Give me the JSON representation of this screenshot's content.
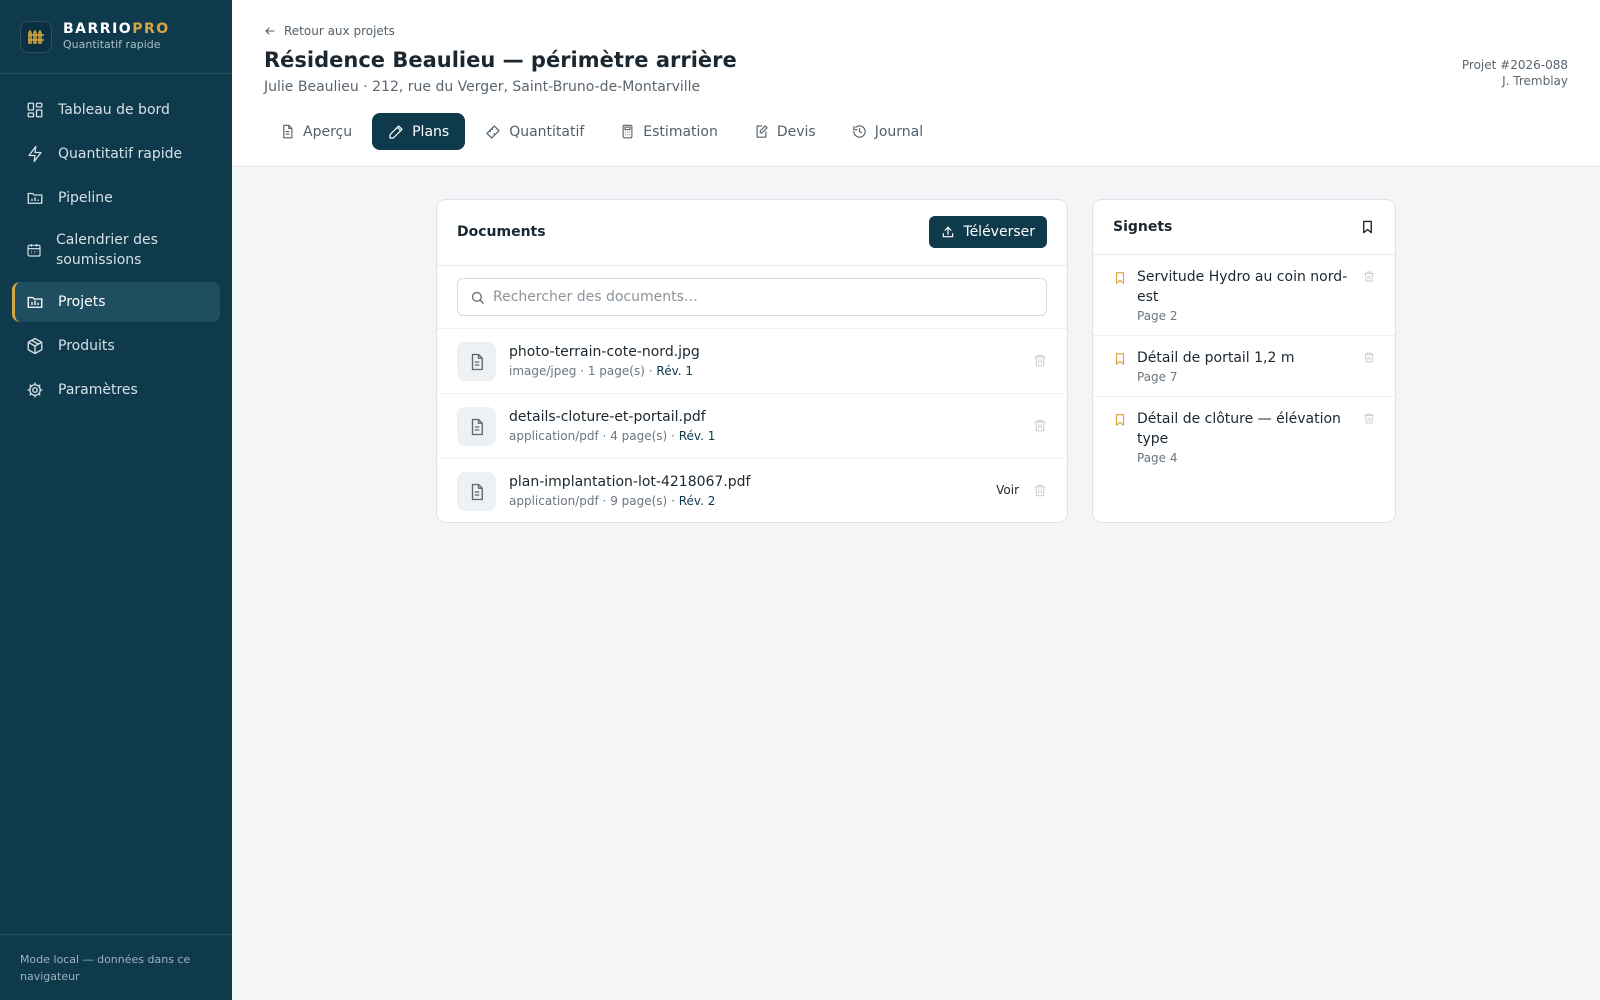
{
  "brand": {
    "name_main": "BARRIO",
    "name_accent": "PRO",
    "subtitle": "Quantitatif rapide"
  },
  "sidebar": {
    "items": [
      {
        "label": "Tableau de bord",
        "icon": "dashboard-icon"
      },
      {
        "label": "Quantitatif rapide",
        "icon": "lightning-icon"
      },
      {
        "label": "Pipeline",
        "icon": "pipeline-icon"
      },
      {
        "label": "Calendrier des soumissions",
        "icon": "calendar-icon"
      },
      {
        "label": "Projets",
        "icon": "projects-icon",
        "active": true
      },
      {
        "label": "Produits",
        "icon": "package-icon"
      },
      {
        "label": "Paramètres",
        "icon": "gear-icon"
      }
    ],
    "footer": "Mode local — données dans ce navigateur"
  },
  "header": {
    "back_label": "Retour aux projets",
    "title": "Résidence Beaulieu — périmètre arrière",
    "subtitle": "Julie Beaulieu · 212, rue du Verger, Saint-Bruno-de-Montarville",
    "project_number": "Projet #2026-088",
    "owner": "J. Tremblay"
  },
  "tabs": [
    {
      "label": "Aperçu",
      "icon": "document-icon"
    },
    {
      "label": "Plans",
      "icon": "pencil-icon",
      "active": true
    },
    {
      "label": "Quantitatif",
      "icon": "ruler-icon"
    },
    {
      "label": "Estimation",
      "icon": "calculator-icon"
    },
    {
      "label": "Devis",
      "icon": "edit-document-icon"
    },
    {
      "label": "Journal",
      "icon": "history-icon"
    }
  ],
  "documents": {
    "title": "Documents",
    "upload_label": "Téléverser",
    "search_placeholder": "Rechercher des documents…",
    "sep": "·",
    "items": [
      {
        "name": "photo-terrain-cote-nord.jpg",
        "type": "image/jpeg",
        "pages": "1 page(s)",
        "rev": "Rév. 1"
      },
      {
        "name": "details-cloture-et-portail.pdf",
        "type": "application/pdf",
        "pages": "4 page(s)",
        "rev": "Rév. 1"
      },
      {
        "name": "plan-implantation-lot-4218067.pdf",
        "type": "application/pdf",
        "pages": "9 page(s)",
        "rev": "Rév. 2",
        "view_label": "Voir"
      }
    ]
  },
  "bookmarks": {
    "title": "Signets",
    "items": [
      {
        "label": "Servitude Hydro au coin nord-est",
        "page": "Page 2"
      },
      {
        "label": "Détail de portail 1,2 m",
        "page": "Page 7"
      },
      {
        "label": "Détail de clôture — élévation type",
        "page": "Page 4"
      }
    ]
  },
  "colors": {
    "sidebar_bg": "#0e3a4b",
    "accent": "#d6a640",
    "active_tab": "#0e3a4b",
    "page_bg": "#f3f5f7"
  }
}
